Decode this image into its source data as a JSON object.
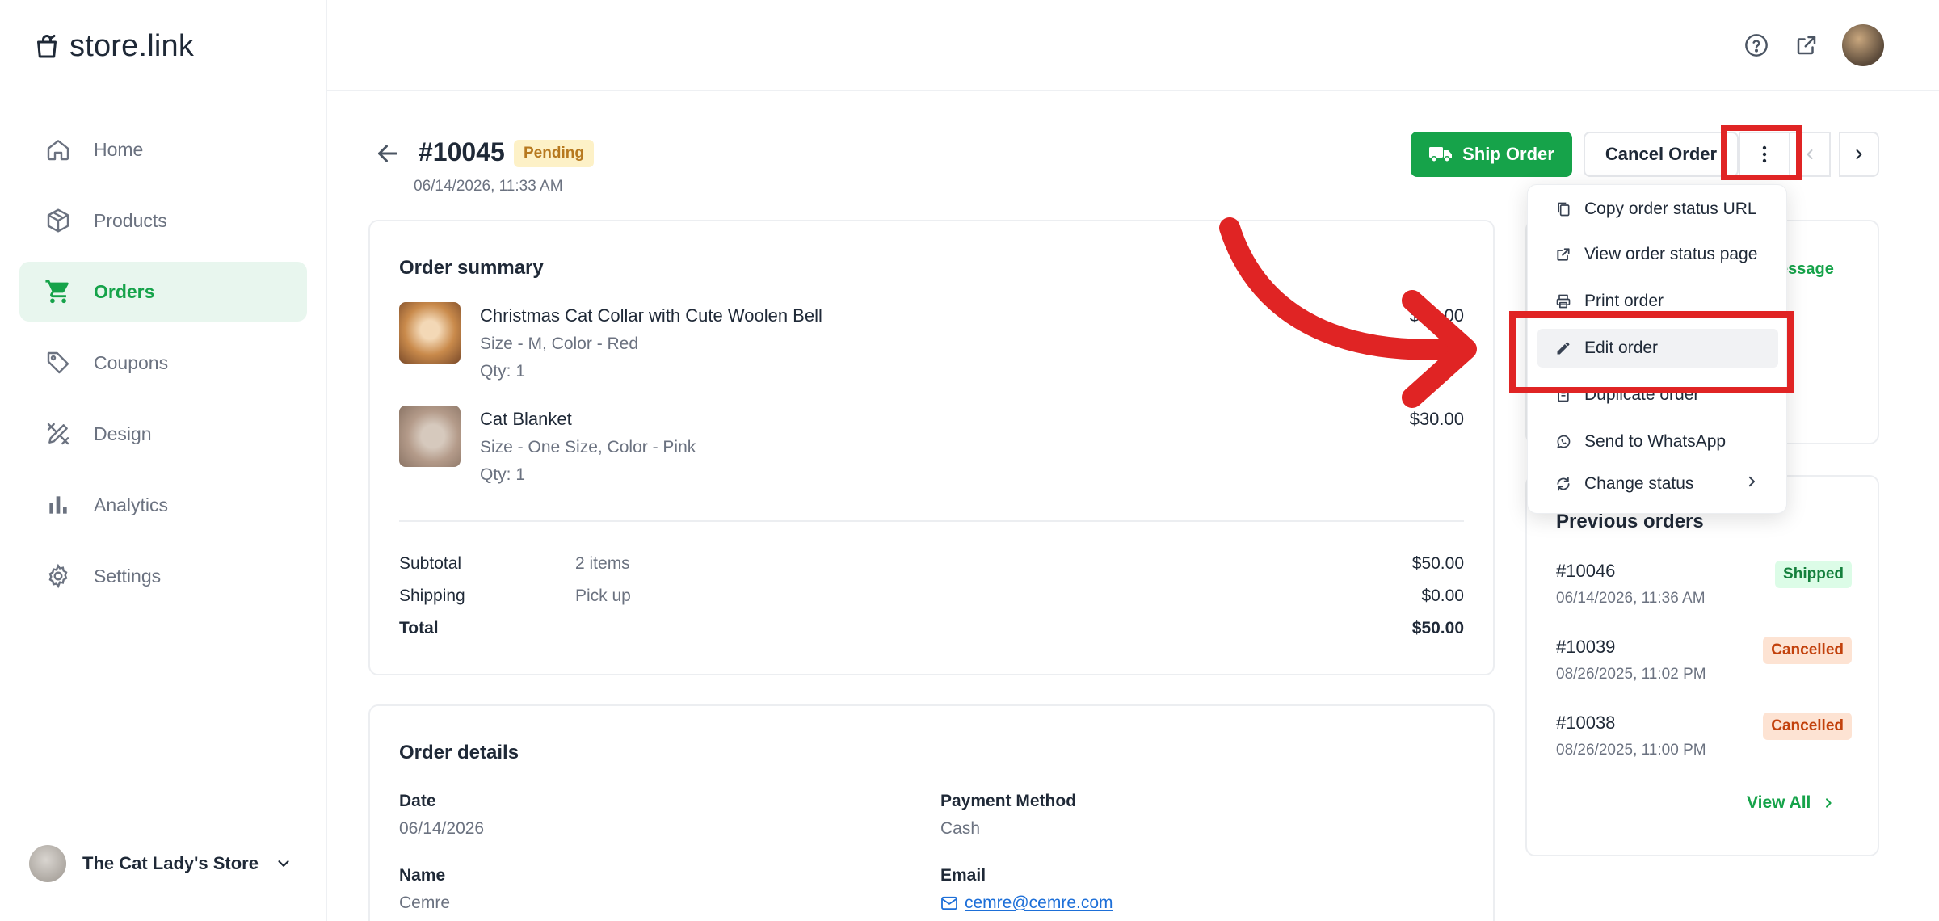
{
  "app": {
    "logo_text": "store.link"
  },
  "sidebar": {
    "items": [
      {
        "label": "Home",
        "icon": "home-icon",
        "active": false
      },
      {
        "label": "Products",
        "icon": "box-icon",
        "active": false
      },
      {
        "label": "Orders",
        "icon": "cart-icon",
        "active": true
      },
      {
        "label": "Coupons",
        "icon": "tag-icon",
        "active": false
      },
      {
        "label": "Design",
        "icon": "design-tools-icon",
        "active": false
      },
      {
        "label": "Analytics",
        "icon": "bar-chart-icon",
        "active": false
      },
      {
        "label": "Settings",
        "icon": "gear-icon",
        "active": false
      }
    ],
    "store_name": "The Cat Lady's Store"
  },
  "topbar": {
    "icons": [
      "help-icon",
      "external-link-icon",
      "user-avatar"
    ]
  },
  "order": {
    "id": "#10045",
    "status": "Pending",
    "date": "06/14/2026, 11:33 AM"
  },
  "actions": {
    "ship_label": "Ship Order",
    "cancel_label": "Cancel Order"
  },
  "summary": {
    "title": "Order summary",
    "items": [
      {
        "name": "Christmas Cat Collar with Cute Woolen Bell",
        "variant": "Size - M, Color - Red",
        "qty": "Qty: 1",
        "price": "$20.00"
      },
      {
        "name": "Cat Blanket",
        "variant": "Size - One Size, Color - Pink",
        "qty": "Qty: 1",
        "price": "$30.00"
      }
    ],
    "subtotal_label": "Subtotal",
    "subtotal_items": "2 items",
    "subtotal_value": "$50.00",
    "shipping_label": "Shipping",
    "shipping_method": "Pick up",
    "shipping_value": "$0.00",
    "total_label": "Total",
    "total_value": "$50.00"
  },
  "details": {
    "title": "Order details",
    "date_label": "Date",
    "date_value": "06/14/2026",
    "payment_label": "Payment Method",
    "payment_value": "Cash",
    "name_label": "Name",
    "name_value": "Cemre",
    "email_label": "Email",
    "email_value": "cemre@cemre.com"
  },
  "customer_card": {
    "message_link": "essage"
  },
  "previous_orders": {
    "title": "Previous orders",
    "orders": [
      {
        "id": "#10046",
        "date": "06/14/2026, 11:36 AM",
        "status": "Shipped"
      },
      {
        "id": "#10039",
        "date": "08/26/2025, 11:02 PM",
        "status": "Cancelled"
      },
      {
        "id": "#10038",
        "date": "08/26/2025, 11:00 PM",
        "status": "Cancelled"
      }
    ],
    "view_all": "View All"
  },
  "menu": {
    "items": [
      {
        "label": "Copy order status URL",
        "icon": "copy-icon"
      },
      {
        "label": "View order status page",
        "icon": "external-link-icon"
      },
      {
        "label": "Print order",
        "icon": "printer-icon"
      },
      {
        "label": "Edit order",
        "icon": "pencil-icon"
      },
      {
        "label": "Duplicate order",
        "icon": "duplicate-icon"
      },
      {
        "label": "Send to WhatsApp",
        "icon": "whatsapp-icon"
      },
      {
        "label": "Change status",
        "icon": "refresh-icon"
      }
    ],
    "highlighted": "Edit order"
  },
  "colors": {
    "brand_green": "#16a34a",
    "active_bg": "#e8f6ee",
    "annotation_red": "#e02424",
    "pending_bg": "#fdf1c7",
    "pending_text": "#b7791f"
  }
}
